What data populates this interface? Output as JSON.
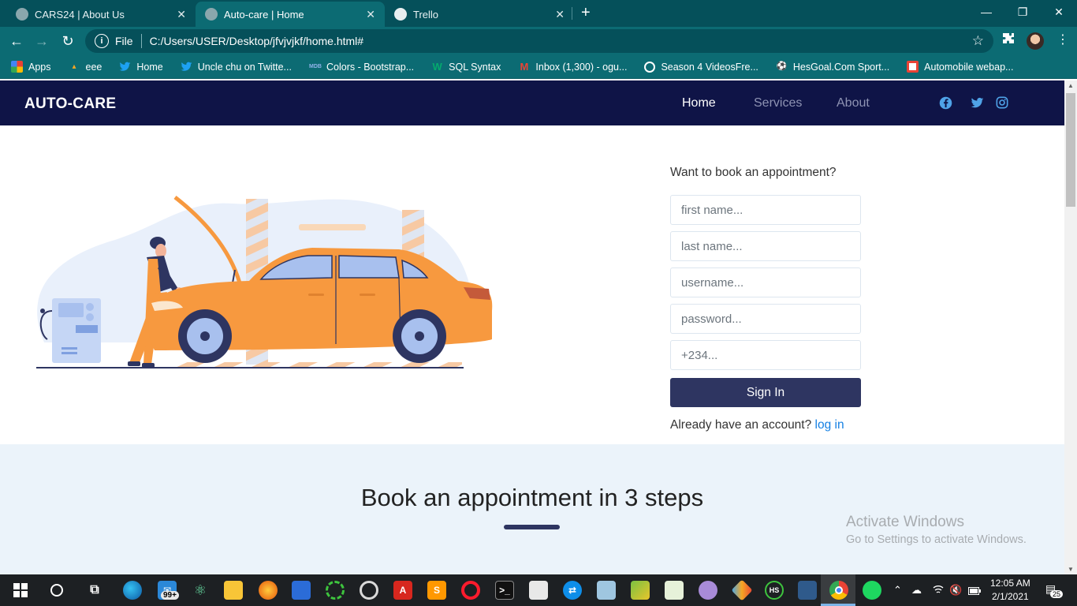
{
  "browser": {
    "tabs": [
      {
        "title": "CARS24 | About Us",
        "active": false
      },
      {
        "title": "Auto-care | Home",
        "active": true
      },
      {
        "title": "Trello",
        "active": false
      }
    ],
    "close_glyph": "✕",
    "new_tab_glyph": "+",
    "window_controls": {
      "minimize": "—",
      "restore": "❐",
      "close": "✕"
    },
    "nav": {
      "back": "←",
      "forward": "→",
      "reload": "↻"
    },
    "address": {
      "scheme_label": "File",
      "url": "C:/Users/USER/Desktop/jfvjvjkf/home.html#"
    },
    "bookmarks": [
      {
        "label": "Apps",
        "icon": "apps-grid-icon",
        "color": "#e94235"
      },
      {
        "label": "eee",
        "icon": "stock-icon",
        "color": "#f5a623"
      },
      {
        "label": "Home",
        "icon": "twitter-icon",
        "color": "#1da1f2"
      },
      {
        "label": "Uncle chu on Twitte...",
        "icon": "twitter-icon",
        "color": "#1da1f2"
      },
      {
        "label": "Colors - Bootstrap...",
        "icon": "mdb-icon",
        "color": "#3f72c4"
      },
      {
        "label": "SQL Syntax",
        "icon": "w3schools-icon",
        "color": "#04aa6d"
      },
      {
        "label": "Inbox (1,300) - ogu...",
        "icon": "gmail-icon",
        "color": "#ea4335"
      },
      {
        "label": "Season 4 VideosFre...",
        "icon": "globe-icon",
        "color": "#ffffff"
      },
      {
        "label": "HesGoal.Com Sport...",
        "icon": "soccer-icon",
        "color": "#ffffff"
      },
      {
        "label": "Automobile webap...",
        "icon": "page-icon",
        "color": "#e94235"
      }
    ]
  },
  "site": {
    "brand": "AUTO-CARE",
    "nav": [
      {
        "label": "Home",
        "active": true
      },
      {
        "label": "Services",
        "active": false
      },
      {
        "label": "About",
        "active": false
      }
    ],
    "social_icons": [
      "facebook-icon",
      "twitter-icon",
      "instagram-icon"
    ],
    "accent_color": "#0f1447",
    "link_color": "#1580e3"
  },
  "form": {
    "heading": "Want to book an appointment?",
    "fields": [
      {
        "placeholder": "first name..."
      },
      {
        "placeholder": "last name..."
      },
      {
        "placeholder": "username..."
      },
      {
        "placeholder": "password..."
      },
      {
        "placeholder": "+234..."
      }
    ],
    "submit_label": "Sign In",
    "login_prompt": "Already have an account?",
    "login_link": "log in"
  },
  "steps": {
    "title": "Book an appointment in 3 steps"
  },
  "watermark": {
    "title": "Activate Windows",
    "subtitle": "Go to Settings to activate Windows."
  },
  "taskbar": {
    "mail_badge": "99+",
    "time": "12:05 AM",
    "date": "2/1/2021",
    "notification_count": "25"
  }
}
